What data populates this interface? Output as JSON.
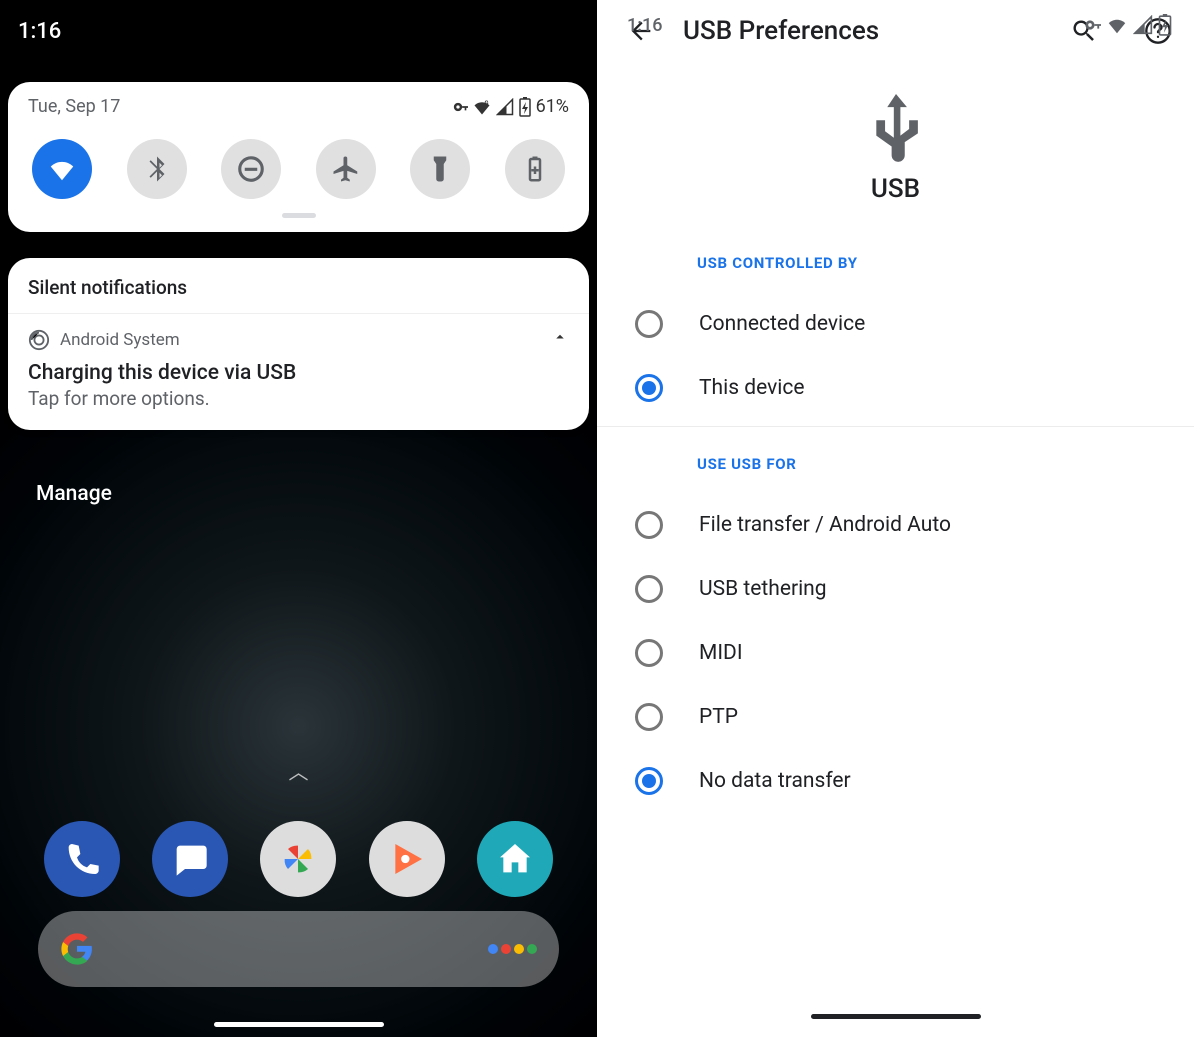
{
  "left": {
    "status_time": "1:16",
    "panel": {
      "date": "Tue, Sep 17",
      "battery_pct": "61%",
      "tiles": [
        {
          "name": "wifi",
          "active": true
        },
        {
          "name": "bluetooth",
          "active": false
        },
        {
          "name": "dnd",
          "active": false
        },
        {
          "name": "airplane",
          "active": false
        },
        {
          "name": "flashlight",
          "active": false
        },
        {
          "name": "battery-saver",
          "active": false
        }
      ]
    },
    "silent_header": "Silent notifications",
    "notification": {
      "app": "Android System",
      "title": "Charging this device via USB",
      "subtitle": "Tap for more options."
    },
    "manage_label": "Manage",
    "dock": [
      "phone",
      "messages",
      "photos",
      "play-music",
      "home"
    ]
  },
  "right": {
    "status_time": "1:16",
    "title": "USB Preferences",
    "hero_label": "USB",
    "section_controlled": "USB CONTROLLED BY",
    "controlled_options": [
      {
        "label": "Connected device",
        "selected": false
      },
      {
        "label": "This device",
        "selected": true
      }
    ],
    "section_use": "USE USB FOR",
    "use_options": [
      {
        "label": "File transfer / Android Auto",
        "selected": false
      },
      {
        "label": "USB tethering",
        "selected": false
      },
      {
        "label": "MIDI",
        "selected": false
      },
      {
        "label": "PTP",
        "selected": false
      },
      {
        "label": "No data transfer",
        "selected": true
      }
    ]
  }
}
